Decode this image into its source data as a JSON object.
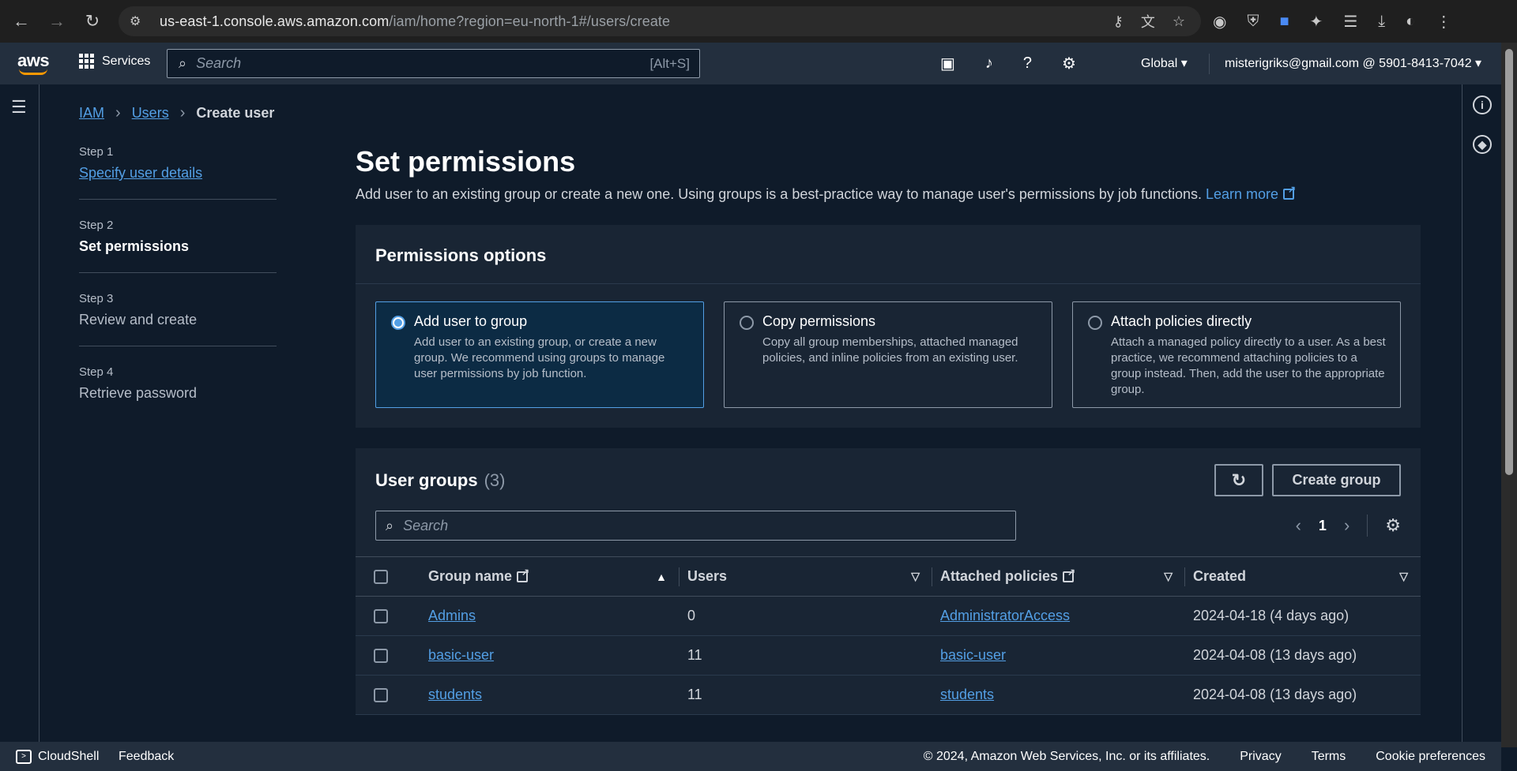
{
  "browser": {
    "url_host": "us-east-1.console.aws.amazon.com",
    "url_path": "/iam/home?region=eu-north-1#/users/create"
  },
  "awsnav": {
    "logo": "aws",
    "services": "Services",
    "search_placeholder": "Search",
    "search_shortcut": "[Alt+S]",
    "region": "Global",
    "account": "misterigriks@gmail.com @ 5901-8413-7042"
  },
  "breadcrumb": {
    "items": [
      "IAM",
      "Users"
    ],
    "current": "Create user"
  },
  "steps": [
    {
      "num": "Step 1",
      "label": "Specify user details"
    },
    {
      "num": "Step 2",
      "label": "Set permissions"
    },
    {
      "num": "Step 3",
      "label": "Review and create"
    },
    {
      "num": "Step 4",
      "label": "Retrieve password"
    }
  ],
  "page": {
    "title": "Set permissions",
    "description": "Add user to an existing group or create a new one. Using groups is a best-practice way to manage user's permissions by job functions.",
    "learn_more": "Learn more"
  },
  "permissions": {
    "heading": "Permissions options",
    "options": [
      {
        "title": "Add user to group",
        "desc": "Add user to an existing group, or create a new group. We recommend using groups to manage user permissions by job function.",
        "selected": true
      },
      {
        "title": "Copy permissions",
        "desc": "Copy all group memberships, attached managed policies, and inline policies from an existing user.",
        "selected": false
      },
      {
        "title": "Attach policies directly",
        "desc": "Attach a managed policy directly to a user. As a best practice, we recommend attaching policies to a group instead. Then, add the user to the appropriate group.",
        "selected": false
      }
    ]
  },
  "groups": {
    "title": "User groups",
    "count": "(3)",
    "create_label": "Create group",
    "search_placeholder": "Search",
    "page": "1",
    "columns": [
      "Group name",
      "Users",
      "Attached policies",
      "Created"
    ],
    "rows": [
      {
        "name": "Admins",
        "users": "0",
        "policies": "AdministratorAccess",
        "created": "2024-04-18 (4 days ago)"
      },
      {
        "name": "basic-user",
        "users": "11",
        "policies": "basic-user",
        "created": "2024-04-08 (13 days ago)"
      },
      {
        "name": "students",
        "users": "11",
        "policies": "students",
        "created": "2024-04-08 (13 days ago)"
      }
    ]
  },
  "footer": {
    "cloudshell": "CloudShell",
    "feedback": "Feedback",
    "copyright": "© 2024, Amazon Web Services, Inc. or its affiliates.",
    "privacy": "Privacy",
    "terms": "Terms",
    "cookies": "Cookie preferences"
  },
  "colors": {
    "accent": "#539fe5",
    "nav_bg": "#232f3e",
    "page_bg": "#0f1b2a",
    "brand_orange": "#ff9900"
  }
}
